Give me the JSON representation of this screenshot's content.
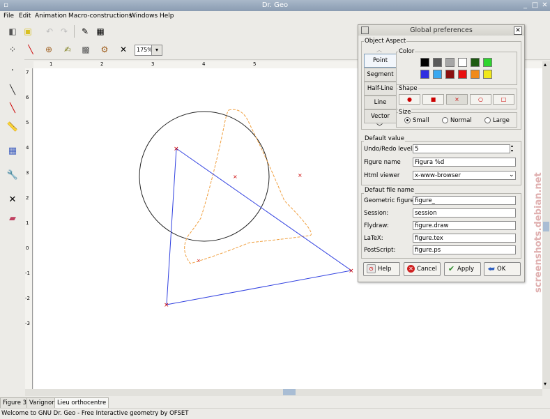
{
  "window": {
    "title": "Dr. Geo"
  },
  "menu": [
    "File",
    "Edit",
    "Animation",
    "Macro-constructions",
    "Windows",
    "Help"
  ],
  "zoom": "175%",
  "ruler": {
    "top_ticks": [
      "1",
      "2",
      "3",
      "4",
      "5"
    ],
    "left_ticks": [
      "7",
      "6",
      "5",
      "4",
      "3",
      "2",
      "1",
      "0",
      "-1",
      "-2",
      "-3"
    ]
  },
  "figure_tabs": [
    "Figure 3",
    "Varignon",
    "Lieu orthocentre"
  ],
  "active_tab": "Lieu orthocentre",
  "status": "Welcome to GNU Dr. Geo - Free Interactive geometry by OFSET",
  "dialog": {
    "title": "Global preferences",
    "object_aspect_label": "Object Aspect",
    "object_types": [
      "Point",
      "Segment",
      "Half-Line",
      "Line",
      "Vector"
    ],
    "selected_type": "Point",
    "color_label": "Color",
    "colors": [
      "#000000",
      "#595959",
      "#a6a6a6",
      "#ffffff",
      "#1e5a12",
      "#2ed42e",
      "#2f2fe0",
      "#3aa8f0",
      "#8a1010",
      "#e81010",
      "#f08a1a",
      "#f0e81a"
    ],
    "shape_label": "Shape",
    "shapes": [
      "●",
      "■",
      "×",
      "○",
      "□"
    ],
    "selected_shape_index": 2,
    "size_label": "Size",
    "sizes": [
      "Small",
      "Normal",
      "Large"
    ],
    "selected_size": "Small",
    "default_value_label": "Default value",
    "undo_label": "Undo/Redo levels",
    "undo_value": "5",
    "figure_name_label": "Figure name",
    "figure_name_value": "Figura %d",
    "html_viewer_label": "Html viewer",
    "html_viewer_value": "x-www-browser",
    "default_file_label": "Defaut file name",
    "geometric_label": "Geometric figure",
    "geometric_value": "figure_",
    "session_label": "Session:",
    "session_value": "session",
    "flydraw_label": "Flydraw:",
    "flydraw_value": "figure.draw",
    "latex_label": "LaTeX:",
    "latex_value": "figure.tex",
    "postscript_label": "PostScript:",
    "postscript_value": "figure.ps",
    "buttons": {
      "help": "Help",
      "cancel": "Cancel",
      "apply": "Apply",
      "ok": "OK"
    }
  },
  "watermark": "screenshots.debian.net"
}
